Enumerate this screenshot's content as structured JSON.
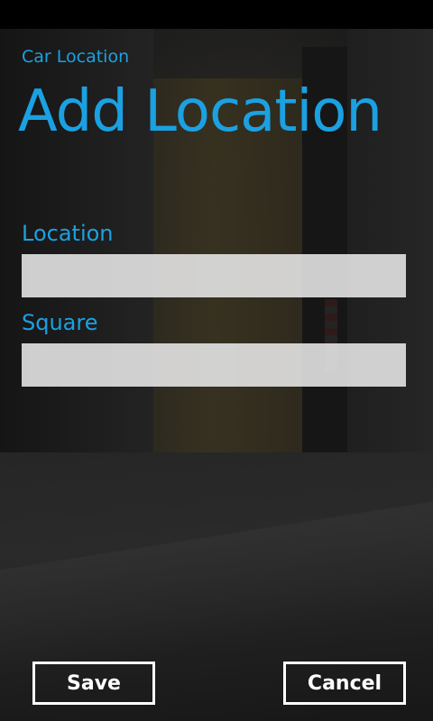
{
  "app": {
    "title": "Car Location"
  },
  "page": {
    "title": "Add Location"
  },
  "form": {
    "fields": [
      {
        "label": "Location",
        "value": "",
        "placeholder": ""
      },
      {
        "label": "Square",
        "value": "",
        "placeholder": ""
      }
    ]
  },
  "actions": {
    "save_label": "Save",
    "cancel_label": "Cancel"
  },
  "theme": {
    "accent": "#1ba1e2",
    "button_border": "#ffffff",
    "input_background": "#e8e8e8"
  }
}
